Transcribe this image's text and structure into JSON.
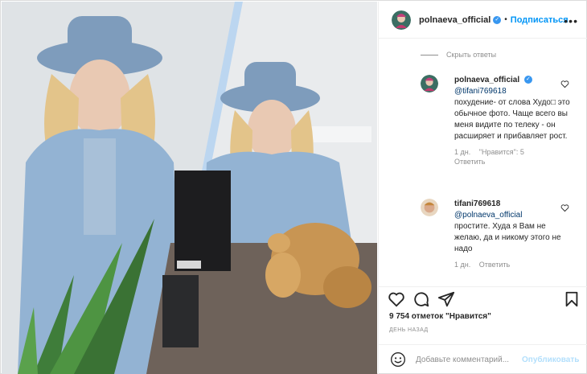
{
  "header": {
    "username": "polnaeva_official",
    "verified_mark": "✓",
    "separator": "•",
    "follow_label": "Подписаться",
    "more_label": "•••"
  },
  "thread": {
    "hide_replies_label": "Скрыть ответы"
  },
  "replies": [
    {
      "username": "polnaeva_official",
      "verified": true,
      "mention": "@tifani769618",
      "text": "похудение- от слова Худо□ это обычное фото. Чаще всего вы меня видите по телеку - он расширяет и прибавляет рост.",
      "age": "1 дн.",
      "likes": "\"Нравится\": 5",
      "reply_label": "Ответить"
    },
    {
      "username": "tifani769618",
      "verified": false,
      "mention": "@polnaeva_official",
      "text": "простите. Худа я Вам не желаю, да и никому этого не надо",
      "age": "1 дн.",
      "reply_label": "Ответить"
    }
  ],
  "post": {
    "likes_text": "9 754 отметок \"Нравится\"",
    "time_ago": "День назад"
  },
  "composer": {
    "placeholder": "Добавьте комментарий...",
    "post_label": "Опубликовать"
  },
  "icons": {
    "like": "heart-icon",
    "comment": "comment-icon",
    "share": "paper-plane-icon",
    "save": "bookmark-icon",
    "emoji": "emoji-icon",
    "options": "more-icon"
  },
  "colors": {
    "accent": "#0095f6",
    "verified": "#3897f0",
    "mention": "#00376b",
    "muted": "#8e8e8e",
    "border": "#efefef"
  }
}
